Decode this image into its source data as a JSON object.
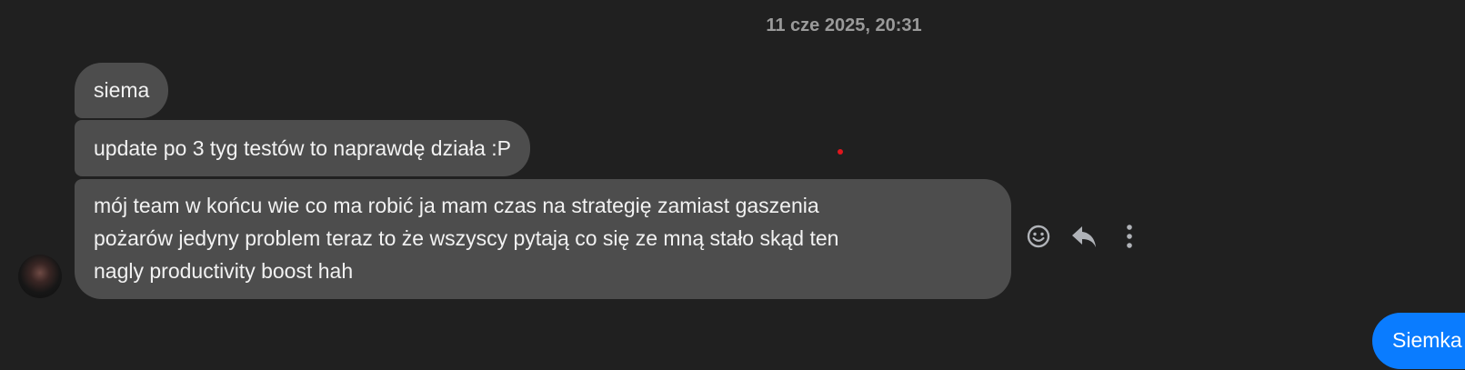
{
  "conversation": {
    "timestamp": "11 cze 2025, 20:31",
    "incoming": [
      {
        "text": "siema"
      },
      {
        "text": "update po 3 tyg testów to naprawdę działa :P"
      },
      {
        "lines": [
          "mój team w końcu wie co ma robić ja mam czas na strategię zamiast gaszenia",
          "pożarów jedyny problem teraz to że wszyscy pytają co się ze mną stało skąd ten",
          "nagly productivity boost hah"
        ]
      }
    ],
    "outgoing": [
      {
        "text": "Siemka"
      }
    ],
    "actions": {
      "react_icon": "smiley-face-icon",
      "reply_icon": "reply-arrow-icon",
      "more_icon": "vertical-ellipsis-icon"
    },
    "colors": {
      "background": "#202020",
      "incoming_bubble": "#4d4d4d",
      "outgoing_bubble": "#0a7cff",
      "timestamp_text": "#9a9a9a"
    }
  }
}
